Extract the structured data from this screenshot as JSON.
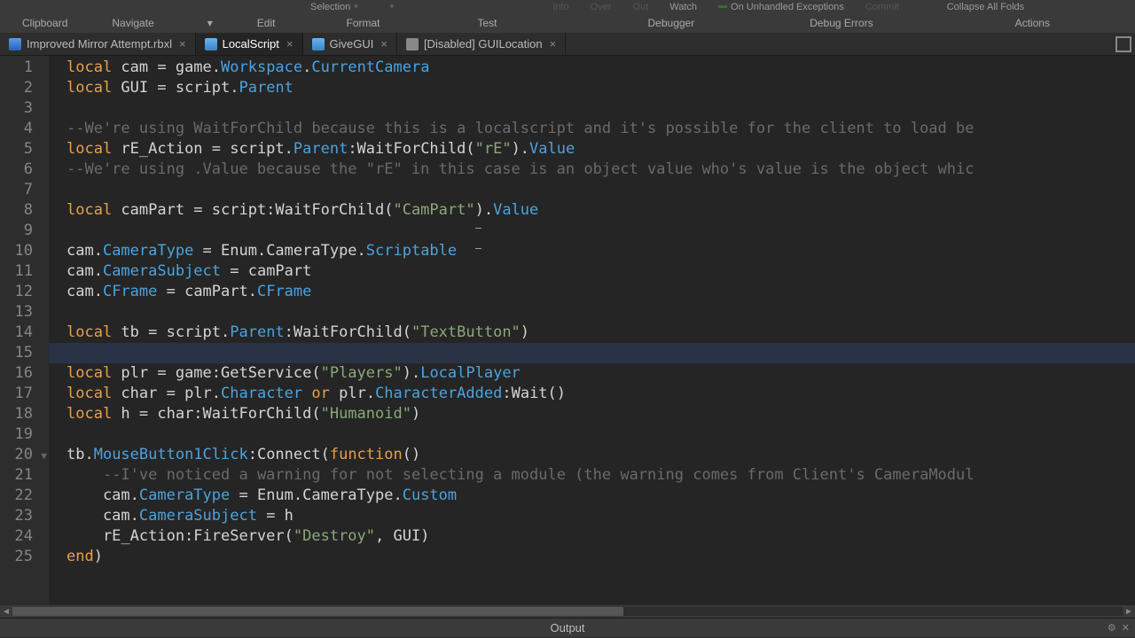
{
  "ribbon_top": {
    "selection": "Selection",
    "into": "Into",
    "over": "Over",
    "out": "Out",
    "watch": "Watch",
    "on_unhandled": "On Unhandled Exceptions",
    "commit": "Commit",
    "collapse": "Collapse All Folds"
  },
  "ribbon_bottom": {
    "clipboard": "Clipboard",
    "navigate": "Navigate",
    "edit": "Edit",
    "format": "Format",
    "test": "Test",
    "debugger": "Debugger",
    "debug_errors": "Debug Errors",
    "actions": "Actions"
  },
  "tabs": [
    {
      "label": "Improved Mirror Attempt.rbxl",
      "active": false,
      "icon": "file"
    },
    {
      "label": "LocalScript",
      "active": true,
      "icon": "script"
    },
    {
      "label": "GiveGUI",
      "active": false,
      "icon": "script"
    },
    {
      "label": "[Disabled] GUILocation",
      "active": false,
      "icon": "gui"
    }
  ],
  "code_lines": [
    [
      {
        "c": "kw",
        "t": "local"
      },
      {
        "c": "def",
        "t": " cam = game."
      },
      {
        "c": "fn",
        "t": "Workspace"
      },
      {
        "c": "def",
        "t": "."
      },
      {
        "c": "fn",
        "t": "CurrentCamera"
      }
    ],
    [
      {
        "c": "kw",
        "t": "local"
      },
      {
        "c": "def",
        "t": " GUI = script."
      },
      {
        "c": "fn",
        "t": "Parent"
      }
    ],
    [],
    [
      {
        "c": "com",
        "t": "--We're using WaitForChild because this is a localscript and it's possible for the client to load be"
      }
    ],
    [
      {
        "c": "kw",
        "t": "local"
      },
      {
        "c": "def",
        "t": " rE_Action = script."
      },
      {
        "c": "fn",
        "t": "Parent"
      },
      {
        "c": "def",
        "t": ":WaitForChild("
      },
      {
        "c": "str",
        "t": "\"rE\""
      },
      {
        "c": "def",
        "t": ")."
      },
      {
        "c": "fn",
        "t": "Value"
      }
    ],
    [
      {
        "c": "com",
        "t": "--We're using .Value because the \"rE\" in this case is an object value who's value is the object whic"
      }
    ],
    [],
    [
      {
        "c": "kw",
        "t": "local"
      },
      {
        "c": "def",
        "t": " camPart = script:WaitForChild("
      },
      {
        "c": "str",
        "t": "\"CamPart\""
      },
      {
        "c": "def",
        "t": ")."
      },
      {
        "c": "fn",
        "t": "Value"
      }
    ],
    [],
    [
      {
        "c": "def",
        "t": "cam."
      },
      {
        "c": "fn",
        "t": "CameraType"
      },
      {
        "c": "def",
        "t": " = Enum.CameraType."
      },
      {
        "c": "fn",
        "t": "Scriptable"
      }
    ],
    [
      {
        "c": "def",
        "t": "cam."
      },
      {
        "c": "fn",
        "t": "CameraSubject"
      },
      {
        "c": "def",
        "t": " = camPart"
      }
    ],
    [
      {
        "c": "def",
        "t": "cam."
      },
      {
        "c": "fn",
        "t": "CFrame"
      },
      {
        "c": "def",
        "t": " = camPart."
      },
      {
        "c": "fn",
        "t": "CFrame"
      }
    ],
    [],
    [
      {
        "c": "kw",
        "t": "local"
      },
      {
        "c": "def",
        "t": " tb = script."
      },
      {
        "c": "fn",
        "t": "Parent"
      },
      {
        "c": "def",
        "t": ":WaitForChild("
      },
      {
        "c": "str",
        "t": "\"TextButton\""
      },
      {
        "c": "def",
        "t": ")"
      }
    ],
    [],
    [
      {
        "c": "kw",
        "t": "local"
      },
      {
        "c": "def",
        "t": " plr = game:GetService("
      },
      {
        "c": "str",
        "t": "\"Players\""
      },
      {
        "c": "def",
        "t": ")."
      },
      {
        "c": "fn",
        "t": "LocalPlayer"
      }
    ],
    [
      {
        "c": "kw",
        "t": "local"
      },
      {
        "c": "def",
        "t": " char = plr."
      },
      {
        "c": "fn",
        "t": "Character"
      },
      {
        "c": "def",
        "t": " "
      },
      {
        "c": "kw",
        "t": "or"
      },
      {
        "c": "def",
        "t": " plr."
      },
      {
        "c": "fn",
        "t": "CharacterAdded"
      },
      {
        "c": "def",
        "t": ":Wait()"
      }
    ],
    [
      {
        "c": "kw",
        "t": "local"
      },
      {
        "c": "def",
        "t": " h = char:WaitForChild("
      },
      {
        "c": "str",
        "t": "\"Humanoid\""
      },
      {
        "c": "def",
        "t": ")"
      }
    ],
    [],
    [
      {
        "c": "def",
        "t": "tb."
      },
      {
        "c": "fn",
        "t": "MouseButton1Click"
      },
      {
        "c": "def",
        "t": ":Connect("
      },
      {
        "c": "kw",
        "t": "function"
      },
      {
        "c": "def",
        "t": "()"
      }
    ],
    [
      {
        "c": "def",
        "t": "    "
      },
      {
        "c": "com",
        "t": "--I've noticed a warning for not selecting a module (the warning comes from Client's CameraModul"
      }
    ],
    [
      {
        "c": "def",
        "t": "    cam."
      },
      {
        "c": "fn",
        "t": "CameraType"
      },
      {
        "c": "def",
        "t": " = Enum.CameraType."
      },
      {
        "c": "fn",
        "t": "Custom"
      }
    ],
    [
      {
        "c": "def",
        "t": "    cam."
      },
      {
        "c": "fn",
        "t": "CameraSubject"
      },
      {
        "c": "def",
        "t": " = h"
      }
    ],
    [
      {
        "c": "def",
        "t": "    rE_Action:FireServer("
      },
      {
        "c": "str",
        "t": "\"Destroy\""
      },
      {
        "c": "def",
        "t": ", GUI)"
      }
    ],
    [
      {
        "c": "kw",
        "t": "end"
      },
      {
        "c": "def",
        "t": ")"
      }
    ]
  ],
  "active_line": 15,
  "fold_line": 20,
  "output_label": "Output"
}
